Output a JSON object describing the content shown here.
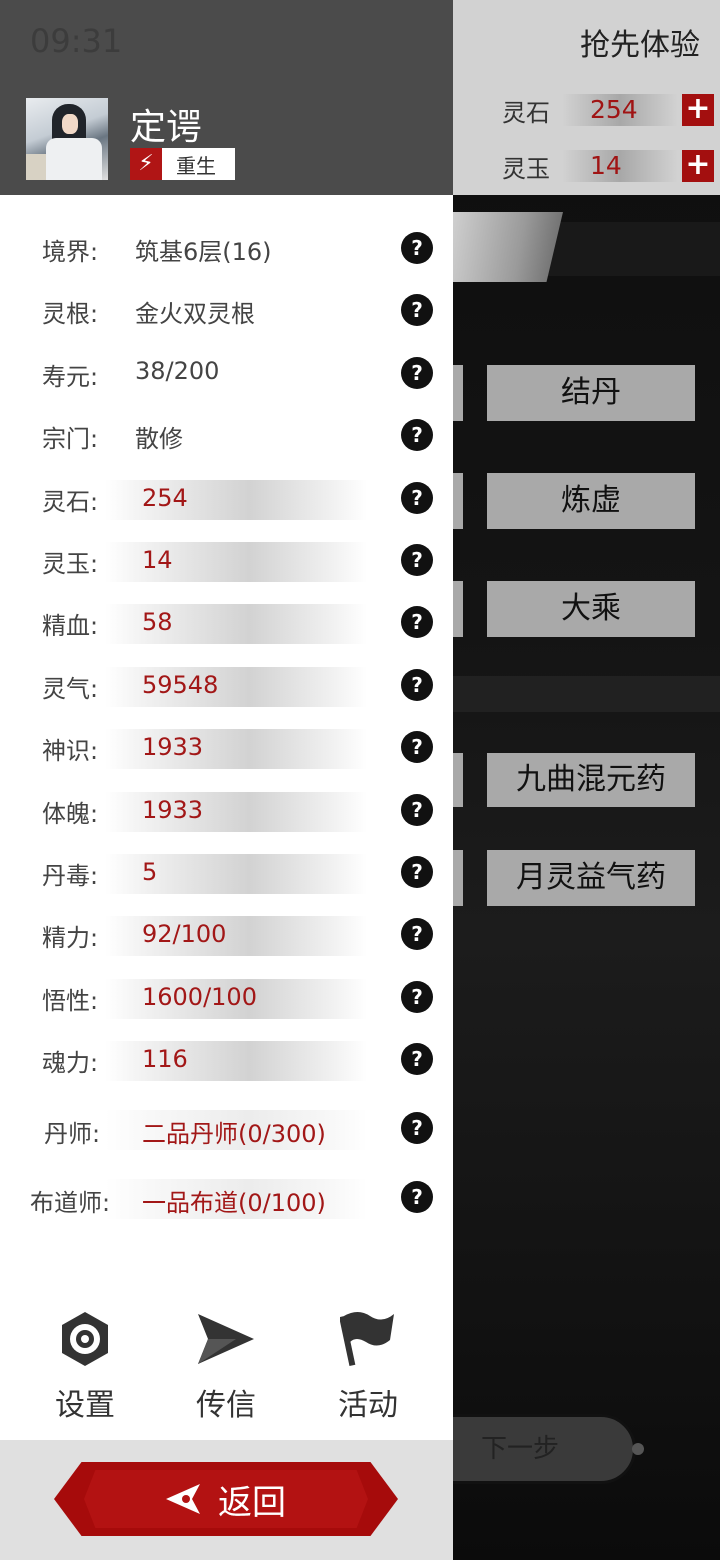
{
  "status_bar": {
    "time": "09:31"
  },
  "background": {
    "early_access": "抢先体验",
    "resources": [
      {
        "name": "灵石",
        "value": "254"
      },
      {
        "name": "灵玉",
        "value": "14"
      }
    ],
    "realm_buttons": [
      "结丹",
      "炼虚",
      "大乘"
    ],
    "potion_buttons": [
      "九曲混元药",
      "月灵益气药"
    ],
    "next_button": "下一步"
  },
  "profile": {
    "name": "定谔",
    "tag": "重生"
  },
  "stats": [
    {
      "label": "境界:",
      "value": "筑基6层(16)",
      "style": "text"
    },
    {
      "label": "灵根:",
      "value": "金火双灵根",
      "style": "text"
    },
    {
      "label": "寿元:",
      "value": "38/200",
      "style": "text"
    },
    {
      "label": "宗门:",
      "value": "散修",
      "style": "text"
    },
    {
      "label": "灵石:",
      "value": "254",
      "style": "bar"
    },
    {
      "label": "灵玉:",
      "value": "14",
      "style": "bar"
    },
    {
      "label": "精血:",
      "value": "58",
      "style": "bar"
    },
    {
      "label": "灵气:",
      "value": "59548",
      "style": "bar"
    },
    {
      "label": "神识:",
      "value": "1933",
      "style": "bar"
    },
    {
      "label": "体魄:",
      "value": "1933",
      "style": "bar"
    },
    {
      "label": "丹毒:",
      "value": "5",
      "style": "bar"
    },
    {
      "label": "精力:",
      "value": "92/100",
      "style": "bar"
    },
    {
      "label": "悟性:",
      "value": "1600/100",
      "style": "bar"
    },
    {
      "label": "魂力:",
      "value": "116",
      "style": "bar"
    },
    {
      "label": "丹师:",
      "value": "二品丹师(0/300)",
      "style": "bar-light"
    },
    {
      "label": "布道师:",
      "value": "一品布道(0/100)",
      "style": "bar-light"
    }
  ],
  "help_symbol": "?",
  "nav": [
    {
      "label": "设置",
      "icon": "gear-icon"
    },
    {
      "label": "传信",
      "icon": "send-icon"
    },
    {
      "label": "活动",
      "icon": "flag-icon"
    }
  ],
  "back_button": {
    "label": "返回",
    "icon": "back-arrow-icon"
  },
  "colors": {
    "accent_red": "#a60b0b",
    "value_red": "#a21717"
  }
}
